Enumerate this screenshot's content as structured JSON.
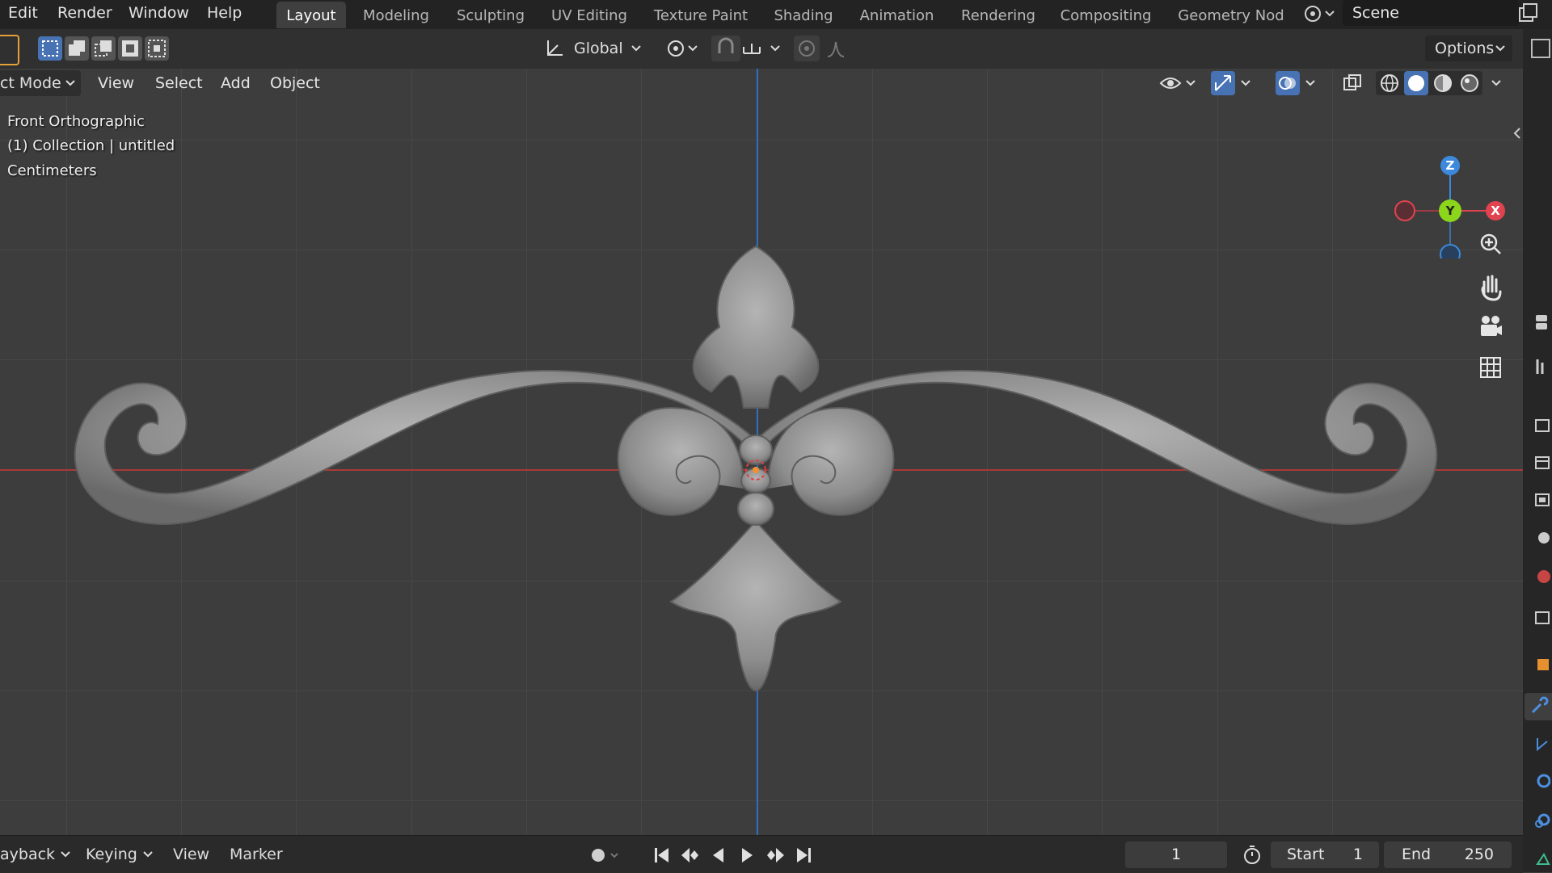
{
  "menu": {
    "edit": "Edit",
    "render": "Render",
    "window": "Window",
    "help": "Help"
  },
  "workspaces": [
    "Layout",
    "Modeling",
    "Sculpting",
    "UV Editing",
    "Texture Paint",
    "Shading",
    "Animation",
    "Rendering",
    "Compositing",
    "Geometry Nod"
  ],
  "active_workspace": "Layout",
  "scene": {
    "name": "Scene"
  },
  "toolbar": {
    "transform_orientation": "Global",
    "options_label": "Options"
  },
  "viewport_header": {
    "mode": "ct Mode",
    "view": "View",
    "select": "Select",
    "add": "Add",
    "object": "Object"
  },
  "viewport_overlay": {
    "line1": "Front Orthographic",
    "line2": "(1) Collection | untitled",
    "line3": "Centimeters"
  },
  "gizmo": {
    "z": "Z",
    "y": "Y",
    "x": "X"
  },
  "timeline": {
    "playback": "ayback",
    "keying": "Keying",
    "view": "View",
    "marker": "Marker",
    "current_frame": "1",
    "start_label": "Start",
    "start_value": "1",
    "end_label": "End",
    "end_value": "250"
  },
  "colors": {
    "accent": "#4772b3",
    "axis_x": "#e0434f",
    "axis_y": "#8bd61a",
    "axis_z": "#3c89db"
  }
}
